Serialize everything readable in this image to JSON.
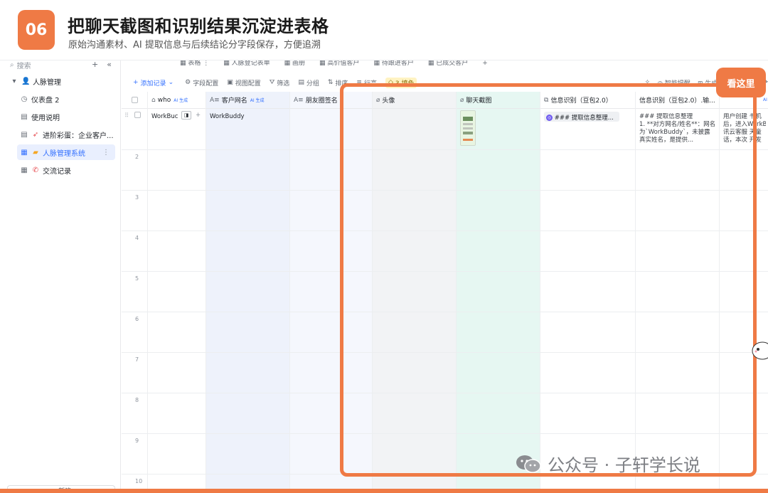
{
  "banner": {
    "step": "06",
    "title": "把聊天截图和识别结果沉淀进表格",
    "subtitle": "原始沟通素材、AI 提取信息与后续结论分字段保存，方便追溯"
  },
  "sidebar": {
    "search_placeholder": "搜索",
    "add_icon": "+",
    "collapse_icon": "«",
    "root": "人脉管理",
    "items": [
      {
        "label": "仪表盘 2",
        "icon": "dashboard-icon"
      },
      {
        "label": "使用说明",
        "icon": "doc-icon"
      },
      {
        "label": "进阶彩蛋：企业客户...",
        "icon": "doc-icon"
      },
      {
        "label": "人脉管理系统",
        "icon": "table-icon"
      },
      {
        "label": "交流记录",
        "icon": "table-icon"
      }
    ],
    "bottom_label": "+ 新建"
  },
  "view_tabs": [
    "表格",
    "人脉登记表单",
    "画册",
    "高价值客户",
    "待跟进客户",
    "已成交客户",
    "+"
  ],
  "toolbar": {
    "add_record": "添加记录",
    "field_config": "字段配置",
    "view_config": "视图配置",
    "filter": "筛选",
    "group": "分组",
    "sort": "排序",
    "row_height": "行高",
    "fill_color": "3 填色",
    "smart_alert": "智能提醒",
    "generate_form": "生成表单"
  },
  "columns": [
    {
      "label": "who",
      "icon": "⌂",
      "ai": "AI 生成"
    },
    {
      "label": "客户网名",
      "icon": "A≡",
      "ai": "AI 生成"
    },
    {
      "label": "朋友圈签名",
      "icon": "A≡",
      "ai": ""
    },
    {
      "label": "",
      "icon": "",
      "ai": ""
    },
    {
      "label": "头像",
      "icon": "⌀",
      "ai": ""
    },
    {
      "label": "聊天截图",
      "icon": "⌀",
      "ai": ""
    },
    {
      "label": "信息识别（豆包2.0）",
      "icon": "⧉",
      "ai": ""
    },
    {
      "label": "信息识别（豆包2.0）.输...",
      "icon": "",
      "ai": ""
    },
    {
      "label": "",
      "icon": "",
      "ai": "AI"
    }
  ],
  "rows": {
    "row1": {
      "who": "WorkBuc",
      "nickname": "WorkBuddy",
      "extract_chip": "### 提取信息整理...",
      "extract_output": "### 提取信息整理\n1. **对方网名/姓名**：网名为`WorkBuddy`，未披露真实姓名，是提供...",
      "next_col": "用户创建 书机\n后，进入WorkB\n讯云客服 天童\n话，本次 开发"
    },
    "numbers": [
      "2",
      "3",
      "4",
      "5",
      "6",
      "7",
      "8",
      "9",
      "10"
    ]
  },
  "annotation": {
    "tag": "看这里",
    "color": "#ef7a45"
  },
  "watermark": "公众号 · 子轩学长说"
}
